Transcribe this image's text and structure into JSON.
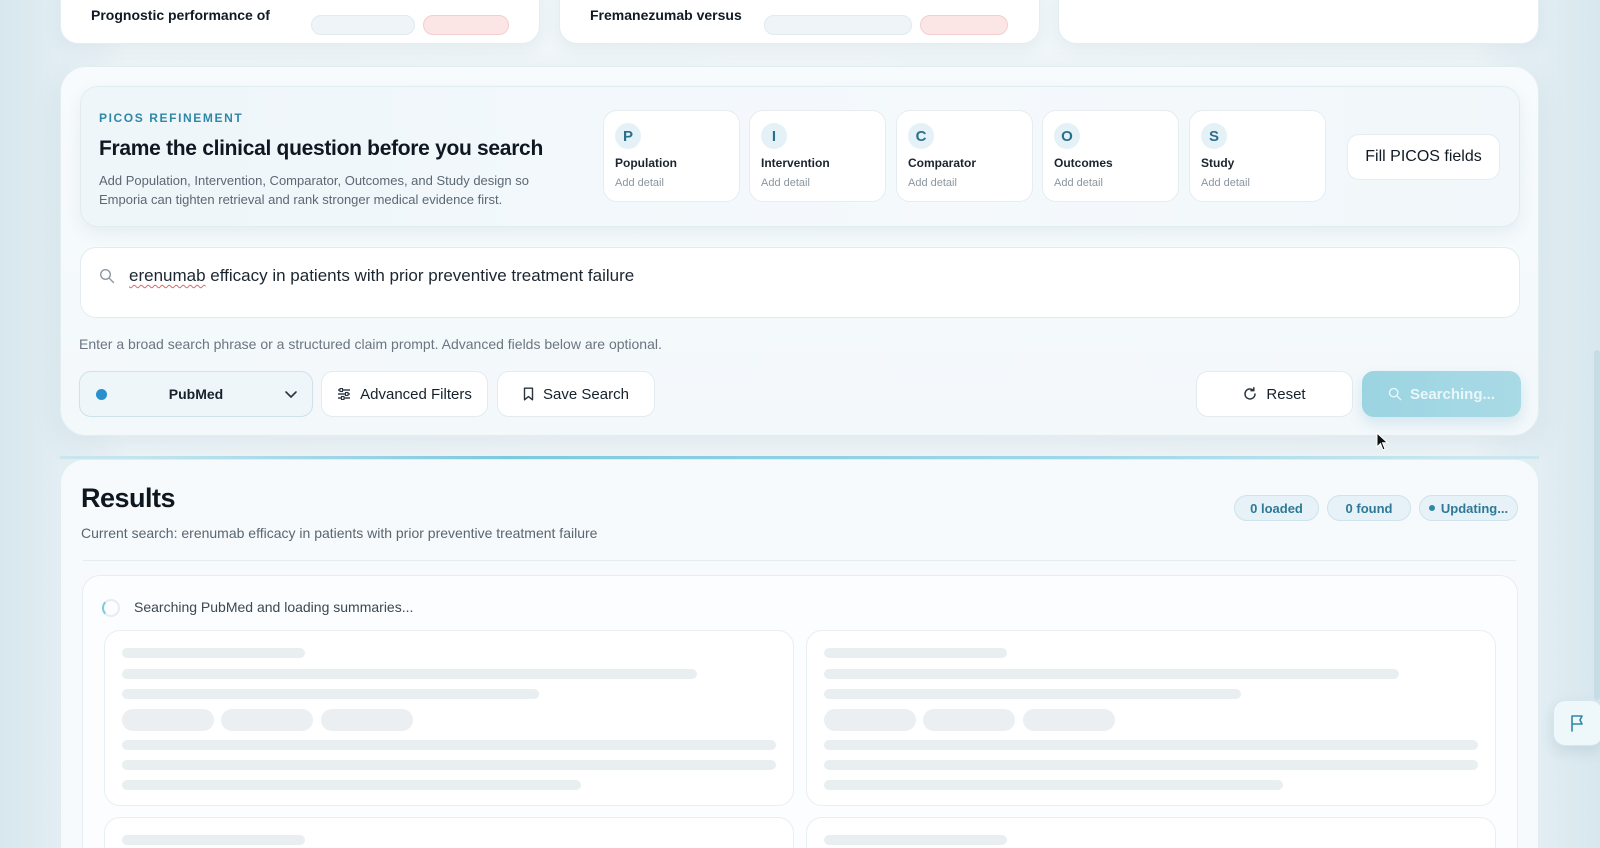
{
  "top_cards": [
    {
      "title": "Prognostic performance of"
    },
    {
      "title": "Fremanezumab versus"
    },
    {
      "title": ""
    }
  ],
  "picos": {
    "eyebrow": "PICOS REFINEMENT",
    "title": "Frame the clinical question before you search",
    "description": "Add Population, Intervention, Comparator, Outcomes, and Study design so Emporia can tighten retrieval and rank stronger medical evidence first.",
    "fields": [
      {
        "letter": "P",
        "name": "Population",
        "detail": "Add detail"
      },
      {
        "letter": "I",
        "name": "Intervention",
        "detail": "Add detail"
      },
      {
        "letter": "C",
        "name": "Comparator",
        "detail": "Add detail"
      },
      {
        "letter": "O",
        "name": "Outcomes",
        "detail": "Add detail"
      },
      {
        "letter": "S",
        "name": "Study",
        "detail": "Add detail"
      }
    ],
    "fill_button": "Fill PICOS fields"
  },
  "search": {
    "query_first_word": "erenumab",
    "query_rest": " efficacy in patients with prior preventive treatment failure",
    "hint": "Enter a broad search phrase or a structured claim prompt. Advanced fields below are optional."
  },
  "controls": {
    "source": "PubMed",
    "advanced_filters": "Advanced Filters",
    "save_search": "Save Search",
    "reset": "Reset",
    "searching": "Searching..."
  },
  "results": {
    "title": "Results",
    "current_search": "Current search: erenumab efficacy in patients with prior preventive treatment failure",
    "badges": {
      "loaded": "0 loaded",
      "found": "0 found",
      "status": "Updating..."
    },
    "loading_text": "Searching PubMed and loading summaries..."
  },
  "colors": {
    "accent": "#2f88a8",
    "searching_button": "#9bd4e1",
    "source_dot": "#2b8fc9"
  },
  "icons": [
    "search-icon",
    "chevron-down-icon",
    "sliders-icon",
    "bookmark-icon",
    "refresh-icon",
    "flag-icon",
    "spinner-icon"
  ]
}
